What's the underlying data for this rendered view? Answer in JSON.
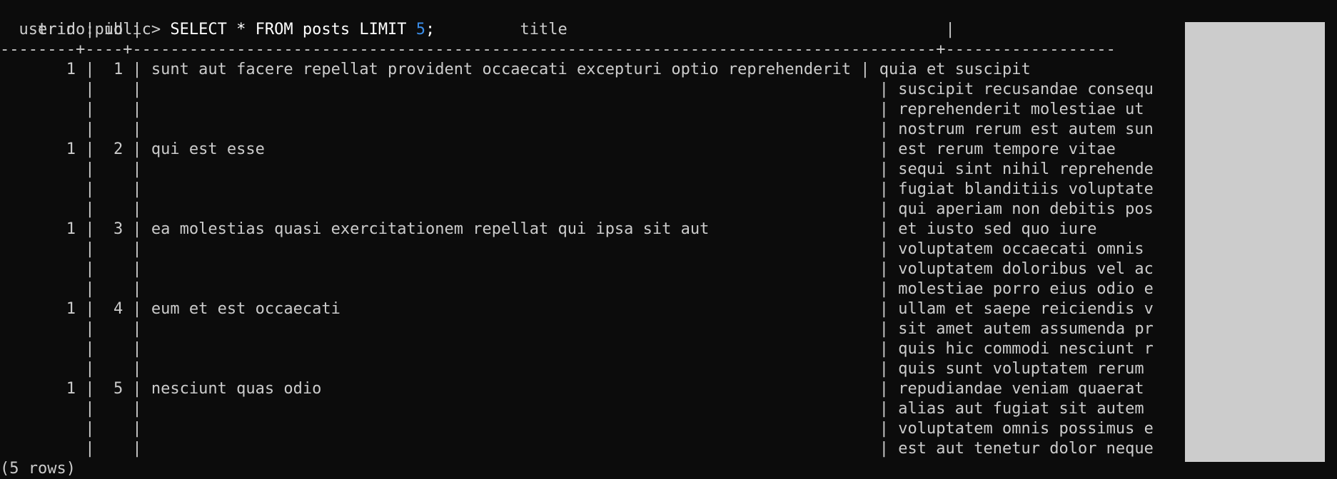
{
  "terminal": {
    "prompt": "trino:public>",
    "command": "SELECT * FROM posts LIMIT ",
    "limit_value": "5",
    "command_end": ";",
    "header": "  userid | id |                                        title                                        |                  ",
    "separator": "--------+----+-------------------------------------------------------------------------------------+------------------",
    "rows": [
      "       1 |  1 | sunt aut facere repellat provident occaecati excepturi optio reprehenderit | quia et suscipit",
      "         |    |                                                                              | suscipit recusandae consequ",
      "         |    |                                                                              | reprehenderit molestiae ut ",
      "         |    |                                                                              | nostrum rerum est autem sun",
      "       1 |  2 | qui est esse                                                                 | est rerum tempore vitae",
      "         |    |                                                                              | sequi sint nihil reprehende",
      "         |    |                                                                              | fugiat blanditiis voluptate",
      "         |    |                                                                              | qui aperiam non debitis pos",
      "       1 |  3 | ea molestias quasi exercitationem repellat qui ipsa sit aut                  | et iusto sed quo iure",
      "         |    |                                                                              | voluptatem occaecati omnis ",
      "         |    |                                                                              | voluptatem doloribus vel ac",
      "         |    |                                                                              | molestiae porro eius odio e",
      "       1 |  4 | eum et est occaecati                                                         | ullam et saepe reiciendis v",
      "         |    |                                                                              | sit amet autem assumenda pr",
      "         |    |                                                                              | quis hic commodi nesciunt r",
      "         |    |                                                                              | quis sunt voluptatem rerum ",
      "       1 |  5 | nesciunt quas odio                                                           | repudiandae veniam quaerat ",
      "         |    |                                                                              | alias aut fugiat sit autem ",
      "         |    |                                                                              | voluptatem omnis possimus e",
      "         |    |                                                                              | est aut tenetur dolor neque"
    ],
    "truncation_marker": ">",
    "footer": "(5 rows)"
  }
}
